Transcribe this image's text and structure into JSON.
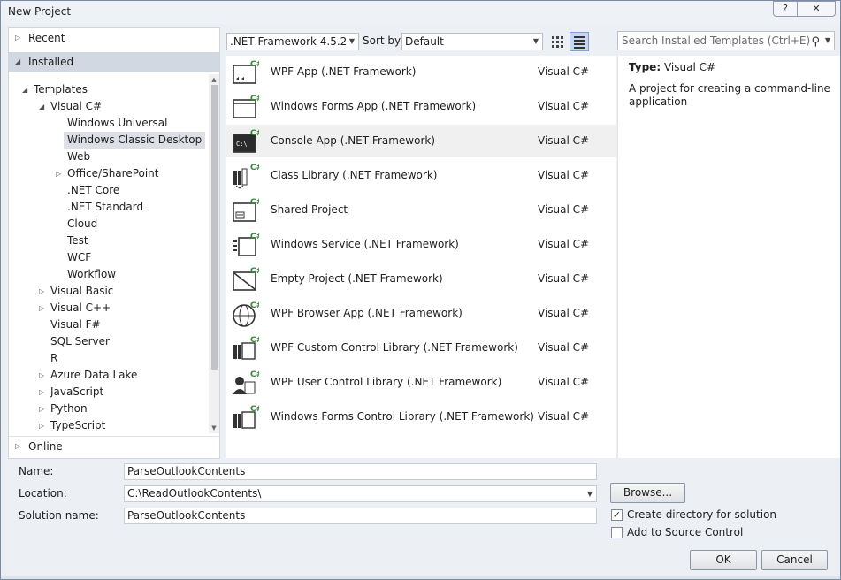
{
  "window": {
    "title": "New Project",
    "help_label": "?",
    "close_label": "✕"
  },
  "left_panel": {
    "recent": "Recent",
    "installed": "Installed",
    "online": "Online",
    "tree": [
      {
        "label": "Templates",
        "level": 0,
        "expander": "expanded"
      },
      {
        "label": "Visual C#",
        "level": 1,
        "expander": "expanded"
      },
      {
        "label": "Windows Universal",
        "level": 2,
        "expander": "none"
      },
      {
        "label": "Windows Classic Desktop",
        "level": 2,
        "expander": "none",
        "selected": true
      },
      {
        "label": "Web",
        "level": 2,
        "expander": "none"
      },
      {
        "label": "Office/SharePoint",
        "level": 2,
        "expander": "collapsed"
      },
      {
        "label": ".NET Core",
        "level": 2,
        "expander": "none"
      },
      {
        "label": ".NET Standard",
        "level": 2,
        "expander": "none"
      },
      {
        "label": "Cloud",
        "level": 2,
        "expander": "none"
      },
      {
        "label": "Test",
        "level": 2,
        "expander": "none"
      },
      {
        "label": "WCF",
        "level": 2,
        "expander": "none"
      },
      {
        "label": "Workflow",
        "level": 2,
        "expander": "none"
      },
      {
        "label": "Visual Basic",
        "level": 1,
        "expander": "collapsed"
      },
      {
        "label": "Visual C++",
        "level": 1,
        "expander": "collapsed"
      },
      {
        "label": "Visual F#",
        "level": 1,
        "expander": "none"
      },
      {
        "label": "SQL Server",
        "level": 1,
        "expander": "none"
      },
      {
        "label": "R",
        "level": 1,
        "expander": "none"
      },
      {
        "label": "Azure Data Lake",
        "level": 1,
        "expander": "collapsed"
      },
      {
        "label": "JavaScript",
        "level": 1,
        "expander": "collapsed"
      },
      {
        "label": "Python",
        "level": 1,
        "expander": "collapsed"
      },
      {
        "label": "TypeScript",
        "level": 1,
        "expander": "collapsed"
      }
    ]
  },
  "toolbar": {
    "framework": ".NET Framework 4.5.2",
    "sort_label": "Sort by:",
    "sort_value": "Default",
    "search_placeholder": "Search Installed Templates (Ctrl+E)"
  },
  "templates": [
    {
      "name": "WPF App (.NET Framework)",
      "language": "Visual C#",
      "icon": "wpf-app-icon"
    },
    {
      "name": "Windows Forms App (.NET Framework)",
      "language": "Visual C#",
      "icon": "windows-forms-app-icon"
    },
    {
      "name": "Console App (.NET Framework)",
      "language": "Visual C#",
      "icon": "console-app-icon",
      "selected": true
    },
    {
      "name": "Class Library (.NET Framework)",
      "language": "Visual C#",
      "icon": "class-library-icon"
    },
    {
      "name": "Shared Project",
      "language": "Visual C#",
      "icon": "shared-project-icon"
    },
    {
      "name": "Windows Service (.NET Framework)",
      "language": "Visual C#",
      "icon": "windows-service-icon"
    },
    {
      "name": "Empty Project (.NET Framework)",
      "language": "Visual C#",
      "icon": "empty-project-icon"
    },
    {
      "name": "WPF Browser App (.NET Framework)",
      "language": "Visual C#",
      "icon": "wpf-browser-app-icon"
    },
    {
      "name": "WPF Custom Control Library (.NET Framework)",
      "language": "Visual C#",
      "icon": "wpf-custom-control-library-icon"
    },
    {
      "name": "WPF User Control Library (.NET Framework)",
      "language": "Visual C#",
      "icon": "wpf-user-control-library-icon"
    },
    {
      "name": "Windows Forms Control Library (.NET Framework)",
      "language": "Visual C#",
      "icon": "windows-forms-control-library-icon"
    }
  ],
  "description": {
    "type_label": "Type:",
    "type_value": "Visual C#",
    "text": "A project for creating a command-line application"
  },
  "form": {
    "name_label": "Name:",
    "name_value": "ParseOutlookContents",
    "location_label": "Location:",
    "location_value": "C:\\ReadOutlookContents\\",
    "solution_label": "Solution name:",
    "solution_value": "ParseOutlookContents",
    "browse_label": "Browse...",
    "create_dir_label": "Create directory for solution",
    "create_dir_checked": true,
    "source_control_label": "Add to Source Control",
    "source_control_checked": false,
    "ok_label": "OK",
    "cancel_label": "Cancel"
  }
}
